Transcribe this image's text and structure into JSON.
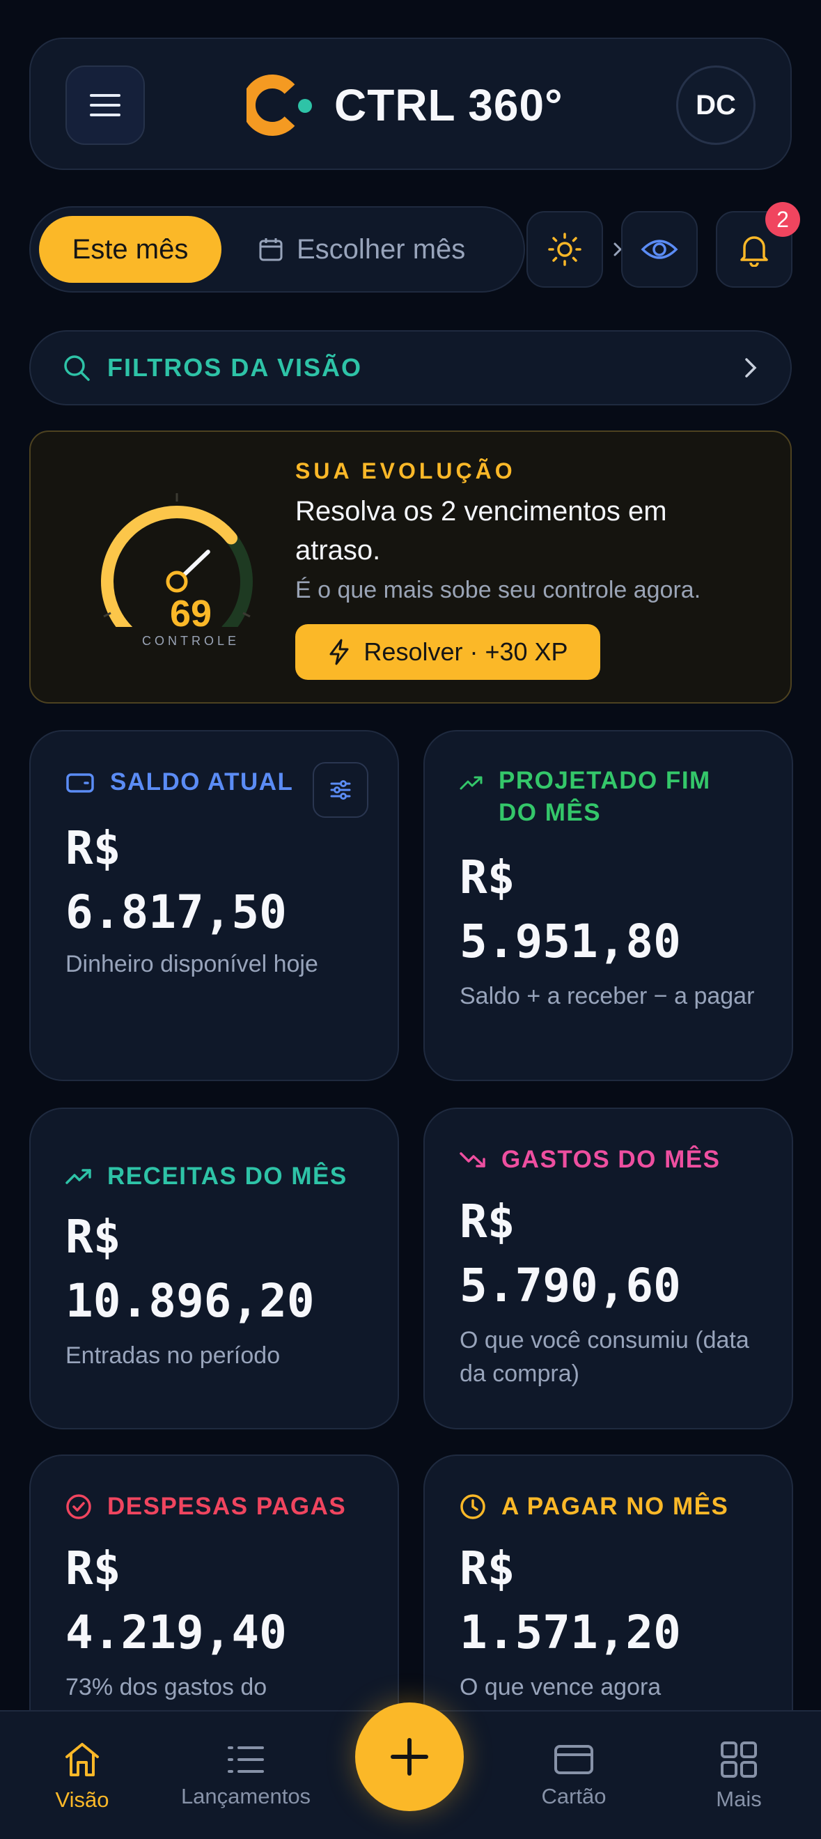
{
  "header": {
    "brand": "CTRL 360°",
    "avatar_initials": "DC"
  },
  "period": {
    "active_label": "Este mês",
    "choose_label": "Escolher mês",
    "notifications_count": "2"
  },
  "filters": {
    "label": "FILTROS DA VISÃO"
  },
  "evolution": {
    "kicker": "SUA EVOLUÇÃO",
    "title": "Resolva os 2 vencimentos em atraso.",
    "subtitle": "É o que mais sobe seu controle agora.",
    "button_label": "Resolver · +30 XP",
    "score": "69",
    "score_fraction": 0.69,
    "score_label": "CONTROLE"
  },
  "cards": [
    {
      "title": "SALDO ATUAL",
      "value_line1": "R$",
      "value_line2": "6.817,50",
      "desc": "Dinheiro disponível hoje",
      "color": "#5b8cf5",
      "icon": "wallet-icon"
    },
    {
      "title": "PROJETADO FIM DO MÊS",
      "value_line1": "R$",
      "value_line2": "5.951,80",
      "desc": "Saldo + a receber − a pagar",
      "color": "#34c76a",
      "icon": "trend-up-icon"
    },
    {
      "title": "RECEITAS DO MÊS",
      "value_line1": "R$",
      "value_line2": "10.896,20",
      "desc": "Entradas no período",
      "color": "#2ec3a7",
      "icon": "trend-up-icon"
    },
    {
      "title": "GASTOS DO MÊS",
      "value_line1": "R$",
      "value_line2": "5.790,60",
      "desc": "O que você consumiu (data da compra)",
      "color": "#ee4fa0",
      "icon": "trend-down-icon"
    },
    {
      "title": "DESPESAS PAGAS",
      "value_line1": "R$",
      "value_line2": "4.219,40",
      "desc": "73% dos gastos do",
      "color": "#f0455f",
      "icon": "check-circle-icon"
    },
    {
      "title": "A PAGAR NO MÊS",
      "value_line1": "R$",
      "value_line2": "1.571,20",
      "desc": "O que vence agora",
      "color": "#fbb828",
      "icon": "clock-icon"
    }
  ],
  "nav": [
    {
      "label": "Visão",
      "icon": "home-icon",
      "active": true
    },
    {
      "label": "Lançamentos",
      "icon": "list-icon"
    },
    {
      "label": "Cartão",
      "icon": "card-icon"
    },
    {
      "label": "Mais",
      "icon": "grid-icon"
    }
  ],
  "colors": {
    "accent": "#fbb828",
    "background": "#060b16",
    "card": "#0f1829"
  }
}
